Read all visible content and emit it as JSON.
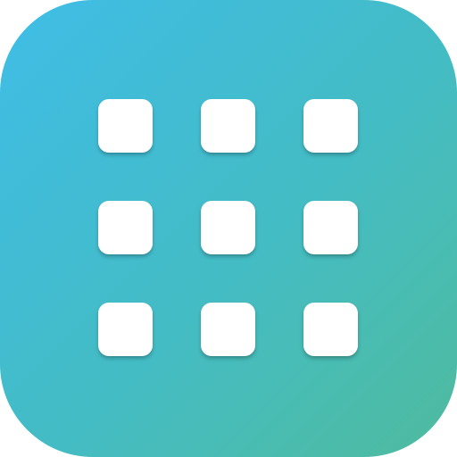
{
  "icon": {
    "name": "app-grid-icon",
    "gradient": [
      "#3fbde6",
      "#44bcc4",
      "#4fbb9e"
    ],
    "tile_color": "#ffffff",
    "grid": {
      "rows": 3,
      "columns": 3,
      "tiles": [
        {
          "name": "grid-tile"
        },
        {
          "name": "grid-tile"
        },
        {
          "name": "grid-tile"
        },
        {
          "name": "grid-tile"
        },
        {
          "name": "grid-tile"
        },
        {
          "name": "grid-tile"
        },
        {
          "name": "grid-tile"
        },
        {
          "name": "grid-tile"
        },
        {
          "name": "grid-tile"
        }
      ]
    }
  }
}
